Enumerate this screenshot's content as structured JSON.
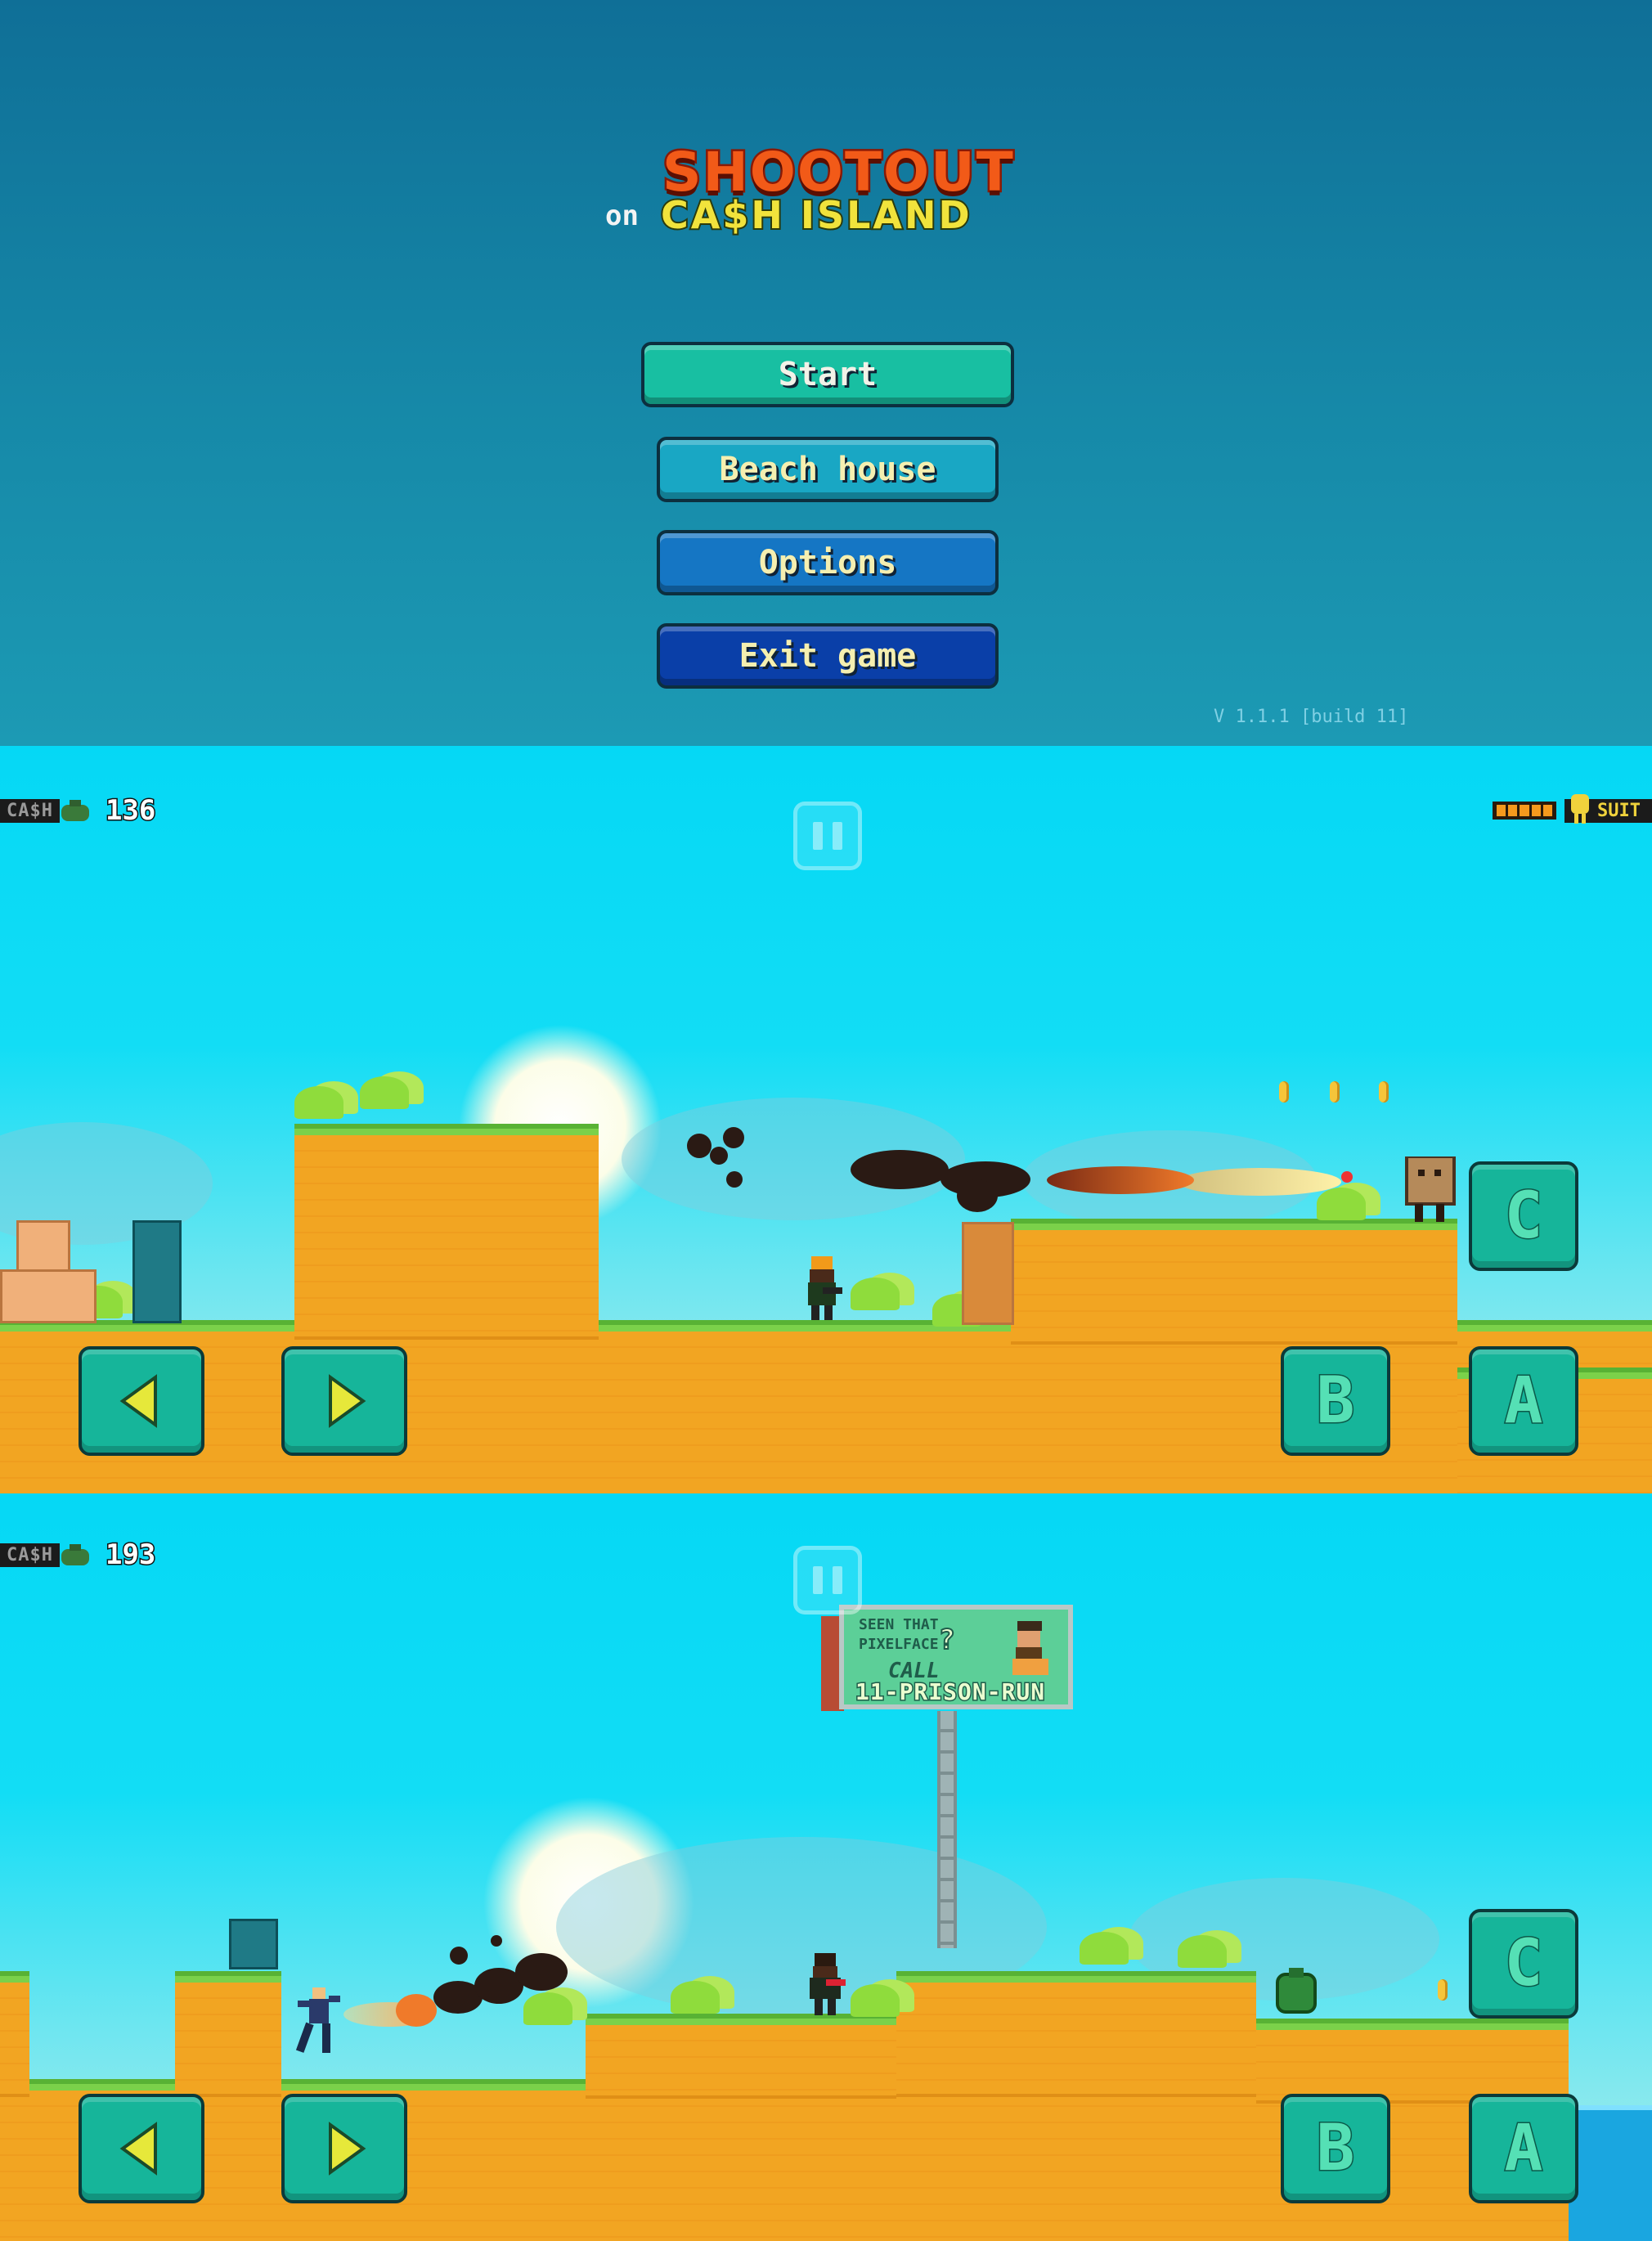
{
  "menu": {
    "title_line1": "SHOOTOUT",
    "title_on": "on",
    "title_line2": "CA$H ISLAND",
    "buttons": {
      "start": "Start",
      "beach_house": "Beach house",
      "options": "Options",
      "exit": "Exit game"
    },
    "version": "V 1.1.1 [build 11]"
  },
  "game1": {
    "cash_label": "CA$H",
    "cash_value": "136",
    "suit_label": "SUIT",
    "health_pips": 5,
    "controls": {
      "left": "left-arrow",
      "right": "right-arrow",
      "b": "B",
      "a": "A",
      "c": "C"
    }
  },
  "game2": {
    "cash_label": "CA$H",
    "cash_value": "193",
    "billboard": {
      "question_line1": "SEEN THAT",
      "question_line2": "PIXELFACE",
      "question_mark": "?",
      "call": "CALL",
      "number": "11-PRISON-RUN"
    },
    "controls": {
      "left": "left-arrow",
      "right": "right-arrow",
      "b": "B",
      "a": "A",
      "c": "C"
    }
  },
  "colors": {
    "button_start": "#18bfa2",
    "button_beach": "#19a7c4",
    "button_options": "#1576c4",
    "button_exit": "#0a3fa8",
    "ground": "#f2a522",
    "grass": "#7bd14a",
    "control": "#16b59a"
  }
}
